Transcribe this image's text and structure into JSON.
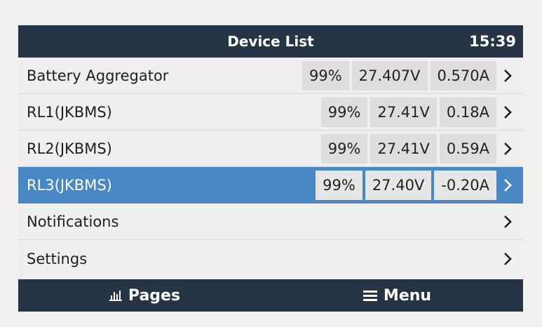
{
  "header": {
    "title": "Device List",
    "clock": "15:39"
  },
  "rows": [
    {
      "label": "Battery Aggregator",
      "values": [
        "99%",
        "27.407V",
        "0.570A"
      ]
    },
    {
      "label": "RL1(JKBMS)",
      "values": [
        "99%",
        "27.41V",
        "0.18A"
      ]
    },
    {
      "label": "RL2(JKBMS)",
      "values": [
        "99%",
        "27.41V",
        "0.59A"
      ]
    },
    {
      "label": "RL3(JKBMS)",
      "values": [
        "99%",
        "27.40V",
        "-0.20A"
      ],
      "selected": true
    },
    {
      "label": "Notifications"
    },
    {
      "label": "Settings"
    }
  ],
  "footer": {
    "pages_label": "Pages",
    "pages_icon": "bar-chart-icon",
    "menu_label": "Menu",
    "menu_icon": "hamburger-icon"
  },
  "colors": {
    "bar": "#263545",
    "selected": "#4a87c5",
    "row": "#efefef",
    "cell": "#dedede"
  }
}
